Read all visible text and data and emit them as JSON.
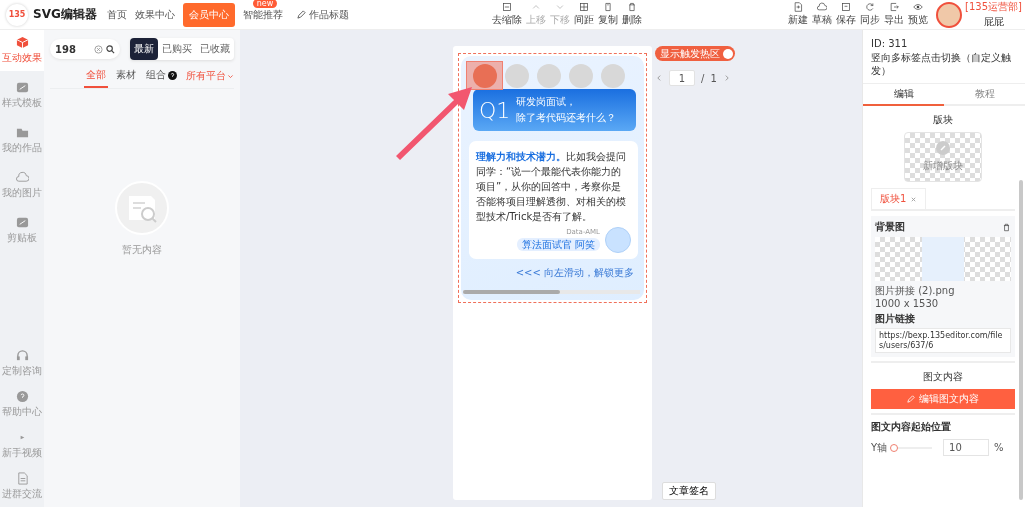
{
  "header": {
    "logo": "135",
    "app_name": "SVG编辑器",
    "nav": [
      {
        "label": "首页",
        "kind": "link",
        "selected": false
      },
      {
        "label": "效果中心",
        "kind": "link",
        "selected": false
      },
      {
        "label": "会员中心",
        "kind": "vip",
        "selected": true
      },
      {
        "label": "智能推荐",
        "kind": "link",
        "selected": false,
        "badge": "new"
      }
    ],
    "doc_title": "作品标题",
    "toolbar": [
      {
        "label": "去缩除",
        "kind": "clear",
        "disabled": false
      },
      {
        "label": "上移",
        "kind": "up",
        "disabled": true
      },
      {
        "label": "下移",
        "kind": "down",
        "disabled": true
      },
      {
        "label": "间距",
        "kind": "spacing",
        "disabled": false
      },
      {
        "label": "复制",
        "kind": "copy",
        "disabled": false
      },
      {
        "label": "删除",
        "kind": "delete",
        "disabled": false
      }
    ],
    "actions": [
      {
        "label": "新建",
        "kind": "new"
      },
      {
        "label": "草稿",
        "kind": "cloud"
      },
      {
        "label": "保存",
        "kind": "save"
      },
      {
        "label": "同步",
        "kind": "sync"
      },
      {
        "label": "导出",
        "kind": "export"
      },
      {
        "label": "预览",
        "kind": "eye"
      }
    ],
    "user": {
      "role": "[135运营部]",
      "name": "屁屁"
    }
  },
  "rail": {
    "items": [
      {
        "label": "互动效果",
        "kind": "cube",
        "selected": true
      },
      {
        "label": "样式模板",
        "kind": "template",
        "selected": false
      },
      {
        "label": "我的作品",
        "kind": "folder",
        "selected": false
      },
      {
        "label": "我的图片",
        "kind": "cloud",
        "selected": false
      },
      {
        "label": "剪贴板",
        "kind": "template",
        "selected": false
      }
    ],
    "bottom": [
      {
        "label": "定制咨询",
        "kind": "headset"
      },
      {
        "label": "帮助中心",
        "kind": "help"
      },
      {
        "label": "新手视频",
        "kind": "video"
      },
      {
        "label": "进群交流",
        "kind": "doc"
      }
    ]
  },
  "library": {
    "search": {
      "value": "198"
    },
    "segments": [
      {
        "label": "最新",
        "selected": true
      },
      {
        "label": "已购买",
        "selected": false
      },
      {
        "label": "已收藏",
        "selected": false
      }
    ],
    "filters": [
      {
        "label": "全部",
        "selected": true,
        "help": false
      },
      {
        "label": "素材",
        "selected": false,
        "help": false
      },
      {
        "label": "组合",
        "selected": false,
        "help": true
      }
    ],
    "platform": "所有平台",
    "empty_text": "暂无内容"
  },
  "canvas": {
    "avatars": [
      {
        "selected": true
      },
      {
        "selected": false
      },
      {
        "selected": false
      },
      {
        "selected": false
      },
      {
        "selected": false
      }
    ],
    "question": {
      "number": "Q1",
      "lines": [
        "研发岗面试，",
        "除了考代码还考什么？"
      ]
    },
    "answer": "**理解力和技术潜力。**比如我会提问同学：“说一个最能代表你能力的项目”，从你的回答中，考察你是否能将项目理解透彻、对相关的模型技术/Trick是否有了解。",
    "signature": "Data-AML",
    "author_tag": "算法面试官 阿笑",
    "hint": "<<< 向左滑动，解锁更多",
    "hotzone_toggle": {
      "label": "显示触发热区",
      "on": true
    },
    "pager": {
      "current": "1",
      "separator": "/",
      "total": "1"
    },
    "signature_button": "文章签名"
  },
  "props": {
    "id": "ID: 311",
    "name": "竖向多标签点击切换（自定义触发）",
    "tabs": [
      {
        "label": "编辑",
        "selected": true
      },
      {
        "label": "教程",
        "selected": false
      }
    ],
    "block_heading": "版块",
    "add_block": "新增版块",
    "block_tabs": [
      {
        "label": "版块1",
        "selected": true
      }
    ],
    "background": {
      "heading": "背景图",
      "filename": "图片拼接 (2).png",
      "size": "1000 x 1530",
      "link_label": "图片链接",
      "link": "https://bexp.135editor.com/files/users/637/6"
    },
    "content_heading": "图文内容",
    "edit_button": "编辑图文内容",
    "position": {
      "heading": "图文内容起始位置",
      "axis": "Y轴",
      "level": 0.05,
      "value": "10",
      "unit": "%"
    }
  }
}
